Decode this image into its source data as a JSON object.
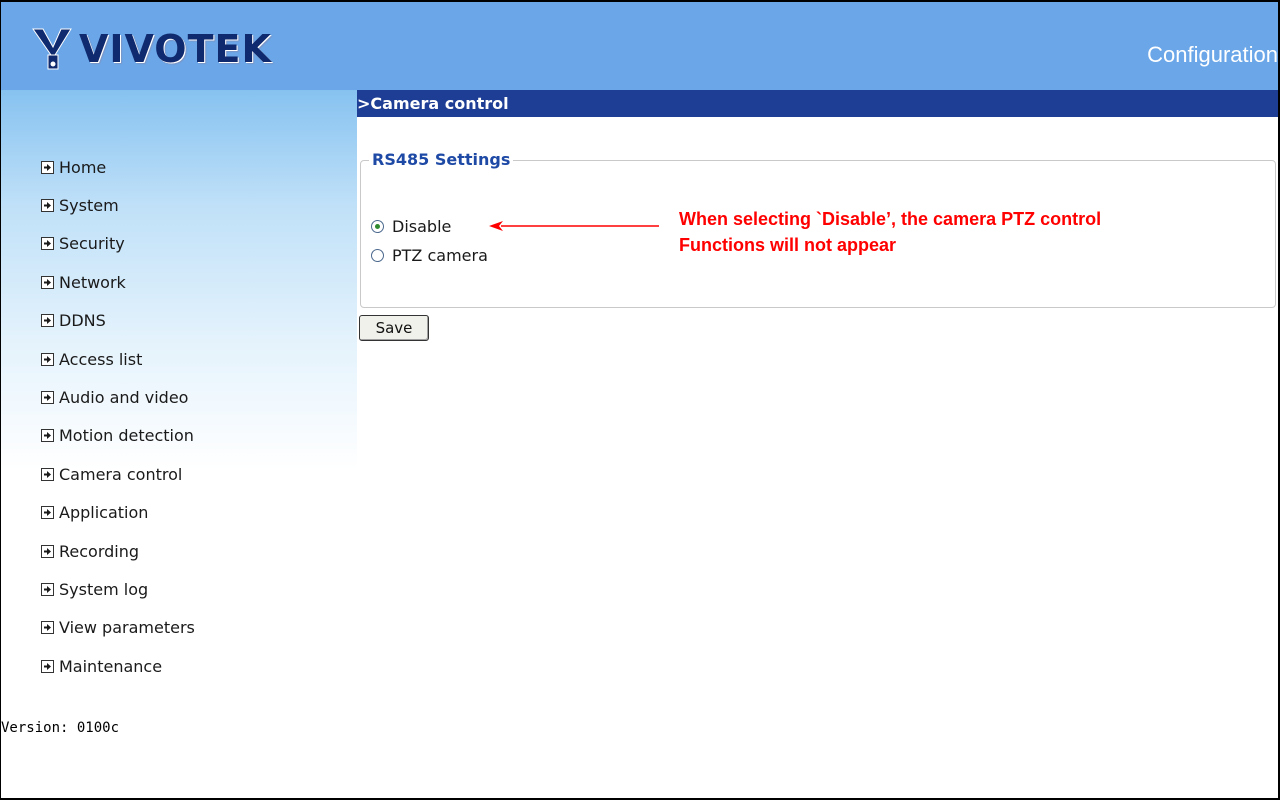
{
  "header": {
    "brand": "VIVOTEK",
    "title": "Configuration"
  },
  "section": {
    "title": ">Camera control"
  },
  "nav": {
    "items": [
      {
        "label": "Home"
      },
      {
        "label": "System"
      },
      {
        "label": "Security"
      },
      {
        "label": "Network"
      },
      {
        "label": "DDNS"
      },
      {
        "label": "Access list"
      },
      {
        "label": "Audio and video"
      },
      {
        "label": "Motion detection"
      },
      {
        "label": "Camera control"
      },
      {
        "label": "Application"
      },
      {
        "label": "Recording"
      },
      {
        "label": "System log"
      },
      {
        "label": "View parameters"
      },
      {
        "label": "Maintenance"
      }
    ]
  },
  "version": "Version: 0100c",
  "rs485": {
    "legend": "RS485 Settings",
    "options": [
      {
        "label": "Disable",
        "checked": true
      },
      {
        "label": "PTZ camera",
        "checked": false
      }
    ]
  },
  "save_label": "Save",
  "annotation": {
    "line1": "When selecting `Disable’, the camera PTZ control",
    "line2": "Functions will not appear",
    "color": "#ff0000"
  },
  "icons": {
    "nav_arrow": "arrow-right-icon",
    "logo": "vivotek-logo-icon"
  },
  "colors": {
    "header": "#6aa6e8",
    "section_bar": "#1e3d94",
    "legend_text": "#1e4aa6"
  }
}
